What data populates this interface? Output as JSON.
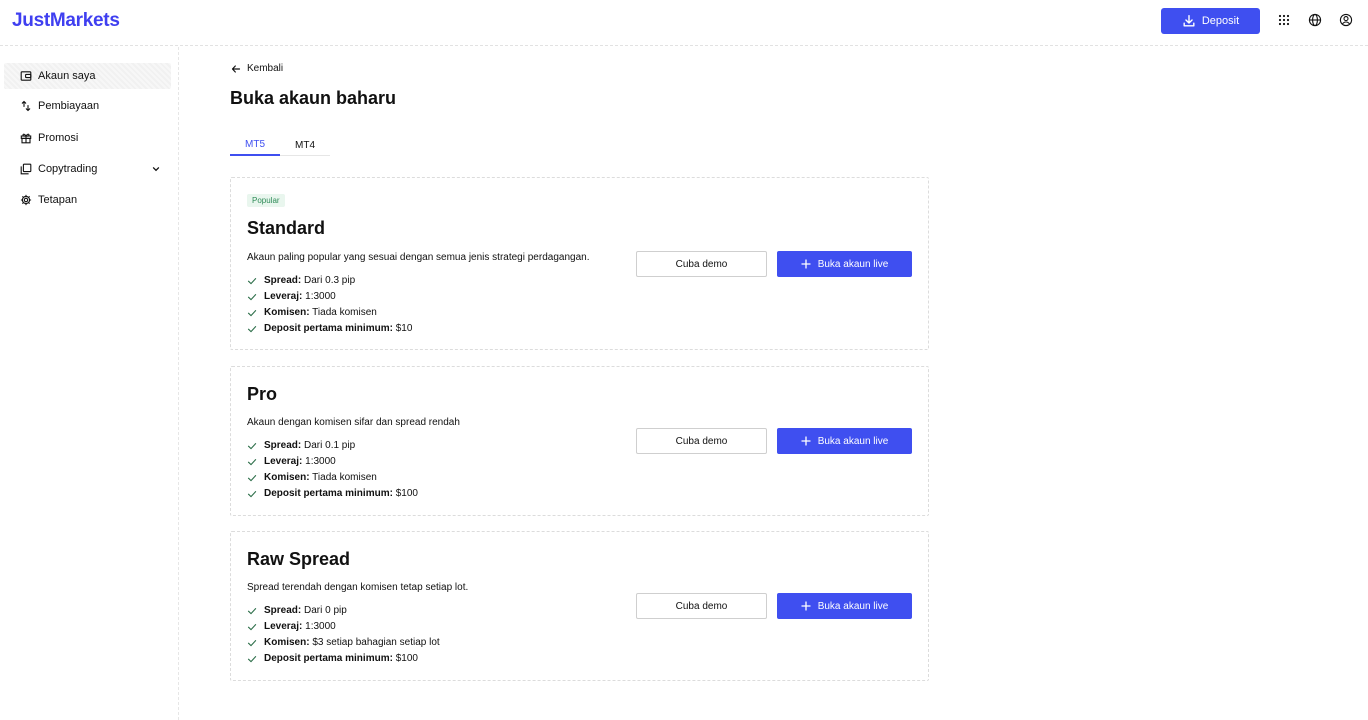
{
  "header": {
    "logo": "JustMarkets",
    "deposit_label": "Deposit",
    "icons": [
      "apps-grid-icon",
      "globe-icon",
      "user-circle-icon"
    ],
    "accent_color": "#3f4ff0"
  },
  "sidebar": {
    "items": [
      {
        "label": "Akaun saya",
        "icon": "wallet-icon",
        "active": true
      },
      {
        "label": "Pembiayaan",
        "icon": "transfer-icon"
      },
      {
        "label": "Promosi",
        "icon": "gift-icon"
      },
      {
        "label": "Copytrading",
        "icon": "copy-icon",
        "expandable": true
      },
      {
        "label": "Tetapan",
        "icon": "gear-icon"
      }
    ]
  },
  "main": {
    "back_label": "Kembali",
    "title": "Buka akaun baharu",
    "tabs": [
      {
        "label": "MT5",
        "active": true
      },
      {
        "label": "MT4"
      }
    ]
  },
  "cards": [
    {
      "badge": "Popular",
      "title": "Standard",
      "description": "Akaun paling popular yang sesuai dengan semua jenis strategi perdagangan.",
      "features": [
        {
          "label": "Spread:",
          "value": "Dari 0.3 pip"
        },
        {
          "label": "Leveraj:",
          "value": "1:3000"
        },
        {
          "label": "Komisen:",
          "value": "Tiada komisen"
        },
        {
          "label": "Deposit pertama minimum:",
          "value": "$10"
        }
      ],
      "demo_label": "Cuba demo",
      "live_label": "Buka akaun live"
    },
    {
      "title": "Pro",
      "description": "Akaun dengan komisen sifar dan spread rendah",
      "features": [
        {
          "label": "Spread:",
          "value": "Dari 0.1 pip"
        },
        {
          "label": "Leveraj:",
          "value": "1:3000"
        },
        {
          "label": "Komisen:",
          "value": "Tiada komisen"
        },
        {
          "label": "Deposit pertama minimum:",
          "value": "$100"
        }
      ],
      "demo_label": "Cuba demo",
      "live_label": "Buka akaun live"
    },
    {
      "title": "Raw Spread",
      "description": "Spread terendah dengan komisen tetap setiap lot.",
      "features": [
        {
          "label": "Spread:",
          "value": "Dari 0 pip"
        },
        {
          "label": "Leveraj:",
          "value": "1:3000"
        },
        {
          "label": "Komisen:",
          "value": "$3 setiap bahagian setiap lot"
        },
        {
          "label": "Deposit pertama minimum:",
          "value": "$100"
        }
      ],
      "demo_label": "Cuba demo",
      "live_label": "Buka akaun live"
    }
  ]
}
